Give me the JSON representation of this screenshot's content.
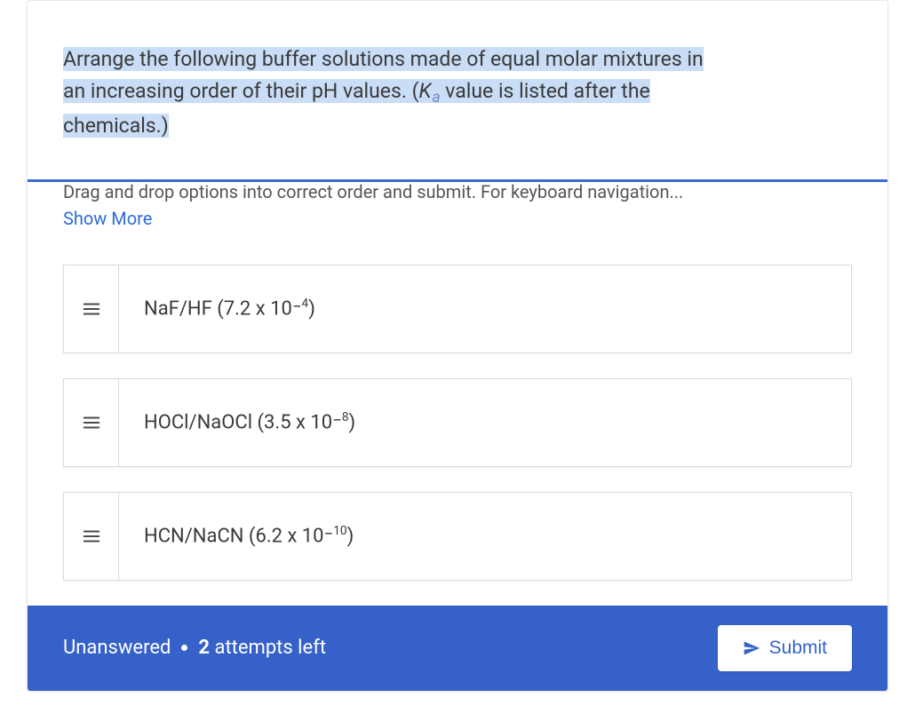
{
  "question": {
    "line1_a": "Arrange the following buffer solutions made of equal molar mixtures in",
    "line2_a": "an increasing order of their pH values. (",
    "k_letter": "K",
    "line2_b": " value is listed after the",
    "line3": "chemicals.)"
  },
  "instruction": {
    "text": "Drag and drop options into correct order and submit. For keyboard navigation...",
    "show_more": "Show More"
  },
  "options": [
    {
      "chem": "NaF/HF ",
      "paren_open": "(7.2 x 10",
      "exp": "4",
      "paren_close": ")"
    },
    {
      "chem": "HOCl/NaOCl ",
      "paren_open": "(3.5 x 10",
      "exp": "8",
      "paren_close": ")"
    },
    {
      "chem": "HCN/NaCN ",
      "paren_open": "(6.2 x 10",
      "exp": "10",
      "paren_close": ")"
    }
  ],
  "footer": {
    "status": "Unanswered",
    "attempts_count": "2",
    "attempts_label": " attempts left",
    "submit_label": "Submit"
  }
}
